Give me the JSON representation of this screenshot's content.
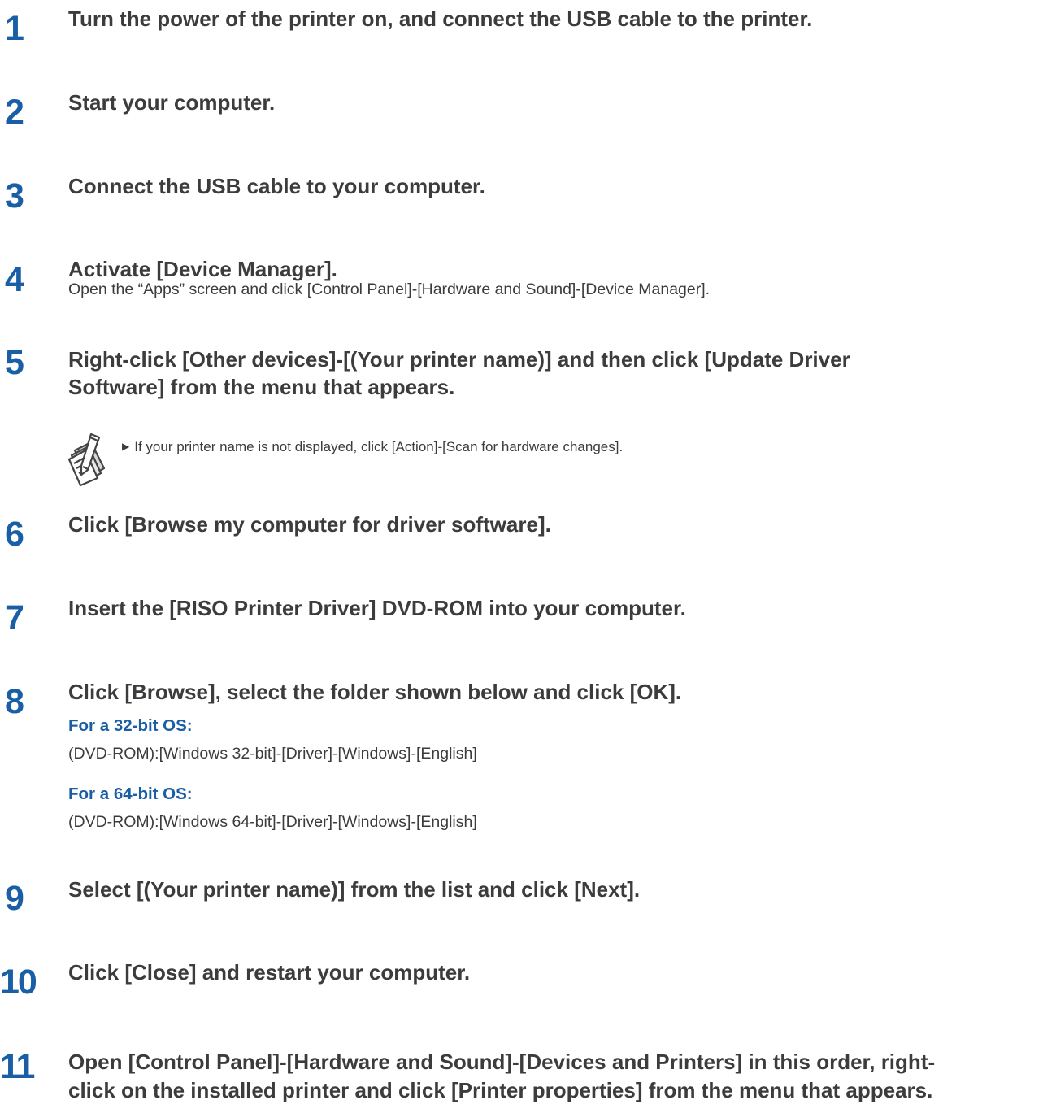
{
  "steps": [
    {
      "num": "1",
      "title": "Turn the power of the printer on, and connect the USB cable to the printer."
    },
    {
      "num": "2",
      "title": "Start your computer."
    },
    {
      "num": "3",
      "title": "Connect the USB cable to your computer."
    },
    {
      "num": "4",
      "title": "Activate [Device Manager].",
      "desc": "Open the “Apps” screen and click [Control Panel]-[Hardware and Sound]-[Device Manager]."
    },
    {
      "num": "5",
      "title_line1": "Right-click [Other devices]-[(Your printer name)] and then click [Update Driver",
      "title_line2": "Software] from the menu that appears."
    },
    {
      "num": "6",
      "title": "Click [Browse my computer for driver software]."
    },
    {
      "num": "7",
      "title": "Insert the [RISO Printer Driver] DVD-ROM into your computer."
    },
    {
      "num": "8",
      "title": "Click [Browse], select the folder shown below and click [OK].",
      "os32_label": "For a 32-bit OS:",
      "os32_path": "(DVD-ROM):[Windows 32-bit]-[Driver]-[Windows]-[English]",
      "os64_label": "For a 64-bit OS:",
      "os64_path": "(DVD-ROM):[Windows 64-bit]-[Driver]-[Windows]-[English]"
    },
    {
      "num": "9",
      "title": "Select [(Your printer name)] from the list and click [Next]."
    },
    {
      "num": "10",
      "title": "Click [Close] and restart your computer."
    },
    {
      "num": "11",
      "title_line1": "Open [Control Panel]-[Hardware and Sound]-[Devices and Printers] in this order, right-",
      "title_line2": "click on the installed printer and click [Printer properties] from the menu that appears."
    }
  ],
  "note": {
    "icon": "memo-pencil-icon",
    "text": "If your printer name is not displayed, click [Action]-[Scan for hardware changes]."
  }
}
